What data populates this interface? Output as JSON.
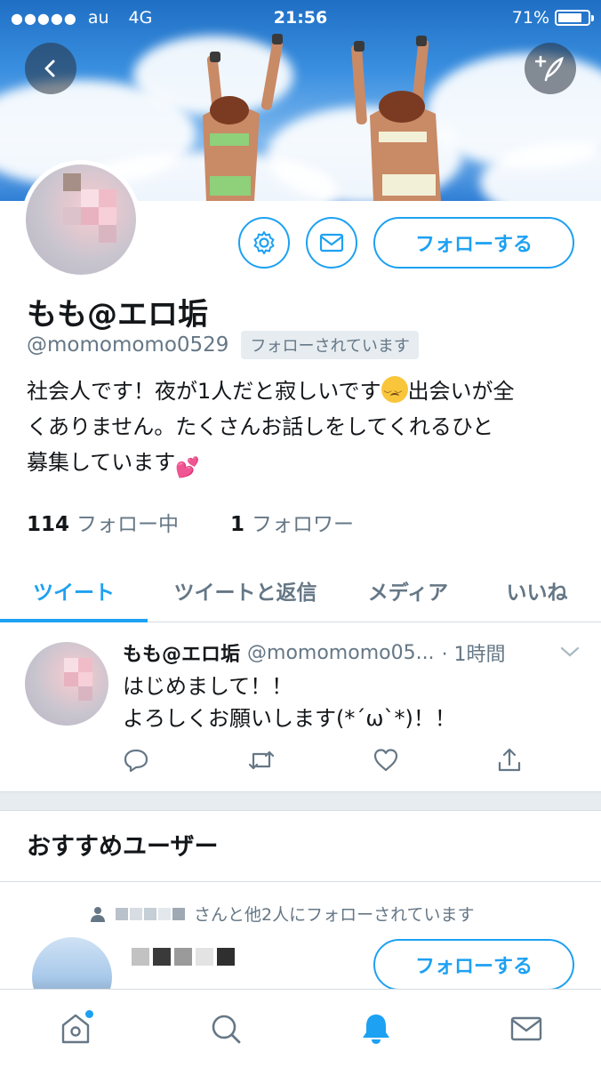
{
  "status_bar": {
    "signal": "●●●●●",
    "carrier": "au",
    "network": "4G",
    "time": "21:56",
    "battery": "71%",
    "battery_level": 0.71
  },
  "profile": {
    "name": "もも@エロ垢",
    "handle": "@momomomo0529",
    "follows_you": "フォローされています",
    "bio_line1_a": "社会人です！夜が1人だと寂しいです",
    "bio_line1_b": "出会いが全",
    "bio_line2": "くありません。たくさんお話しをしてくれるひと",
    "bio_line3": "募集しています",
    "following_count": "114",
    "following_label": "フォロー中",
    "followers_count": "1",
    "followers_label": "フォロワー",
    "follow_button": "フォローする"
  },
  "tabs": [
    {
      "label": "ツイート"
    },
    {
      "label": "ツイートと返信"
    },
    {
      "label": "メディア"
    },
    {
      "label": "いいね"
    }
  ],
  "tweet": {
    "name": "もも@エロ垢",
    "handle": "@momomomo05...",
    "time": "· 1時間",
    "line1": "はじめまして！！",
    "line2": "よろしくお願いします(*´ω`*)！！"
  },
  "recommend": {
    "title": "おすすめユーザー",
    "context": "さんと他2人にフォローされています",
    "follow_button": "フォローする"
  },
  "colors": {
    "accent": "#1da1f2",
    "text": "#14171a",
    "muted": "#657786"
  },
  "icons": [
    "back-icon",
    "compose-icon",
    "gear-icon",
    "mail-icon",
    "reply-icon",
    "retweet-icon",
    "like-icon",
    "share-icon",
    "caret-down-icon",
    "person-icon",
    "home-icon",
    "search-icon",
    "bell-icon"
  ]
}
